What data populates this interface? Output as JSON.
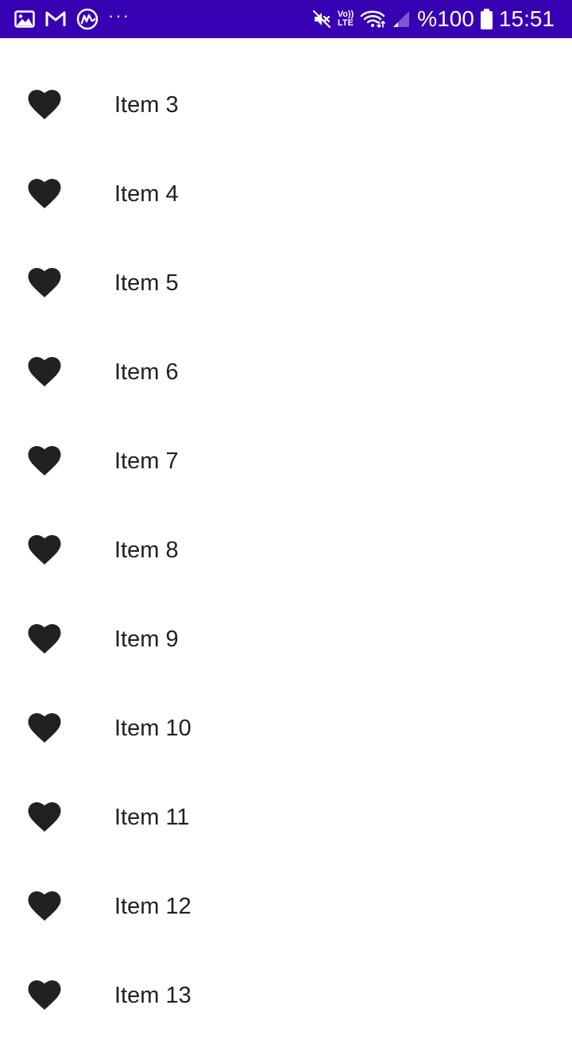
{
  "status_bar": {
    "dots": "···",
    "volte_top": "Vo))",
    "volte_bottom": "LTE",
    "battery_text": "%100",
    "time": "15:51",
    "background_color": "#3700b3",
    "left_icons": [
      "gallery-icon",
      "gmail-icon",
      "coinmarketcap-icon",
      "more-dots-icon"
    ],
    "right_icons": [
      "mute-icon",
      "volte-icon",
      "wifi-icon",
      "signal-icon",
      "battery-icon"
    ]
  },
  "list": {
    "icon": "heart-icon",
    "items": [
      {
        "label": "Item 3"
      },
      {
        "label": "Item 4"
      },
      {
        "label": "Item 5"
      },
      {
        "label": "Item 6"
      },
      {
        "label": "Item 7"
      },
      {
        "label": "Item 8"
      },
      {
        "label": "Item 9"
      },
      {
        "label": "Item 10"
      },
      {
        "label": "Item 11"
      },
      {
        "label": "Item 12"
      },
      {
        "label": "Item 13"
      }
    ]
  }
}
